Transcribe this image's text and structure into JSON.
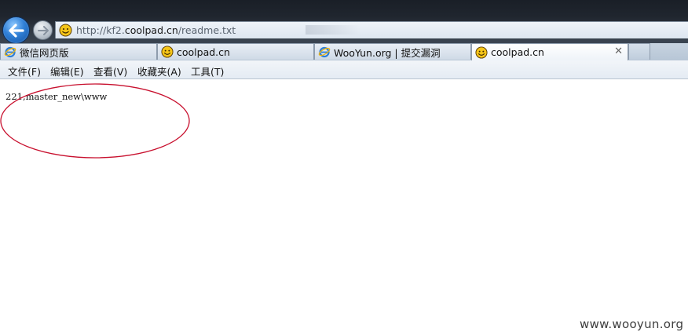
{
  "address_bar": {
    "url_prefix": "http://kf2.",
    "url_host": "coolpad.cn",
    "url_suffix": "/readme.txt"
  },
  "tabs": [
    {
      "label": "微信网页版",
      "icon": "ie-icon",
      "active": false
    },
    {
      "label": "coolpad.cn",
      "icon": "smiley-favicon-icon",
      "active": false
    },
    {
      "label": "WooYun.org | 提交漏洞",
      "icon": "ie-icon",
      "active": false
    },
    {
      "label": "coolpad.cn",
      "icon": "smiley-favicon-icon",
      "active": true,
      "close": "✕"
    }
  ],
  "menu": [
    "文件(F)",
    "编辑(E)",
    "查看(V)",
    "收藏夹(A)",
    "工具(T)"
  ],
  "content": {
    "text": "221,master_new\\www",
    "annotation_color": "#c8102e"
  },
  "watermark": "www.wooyun.org"
}
